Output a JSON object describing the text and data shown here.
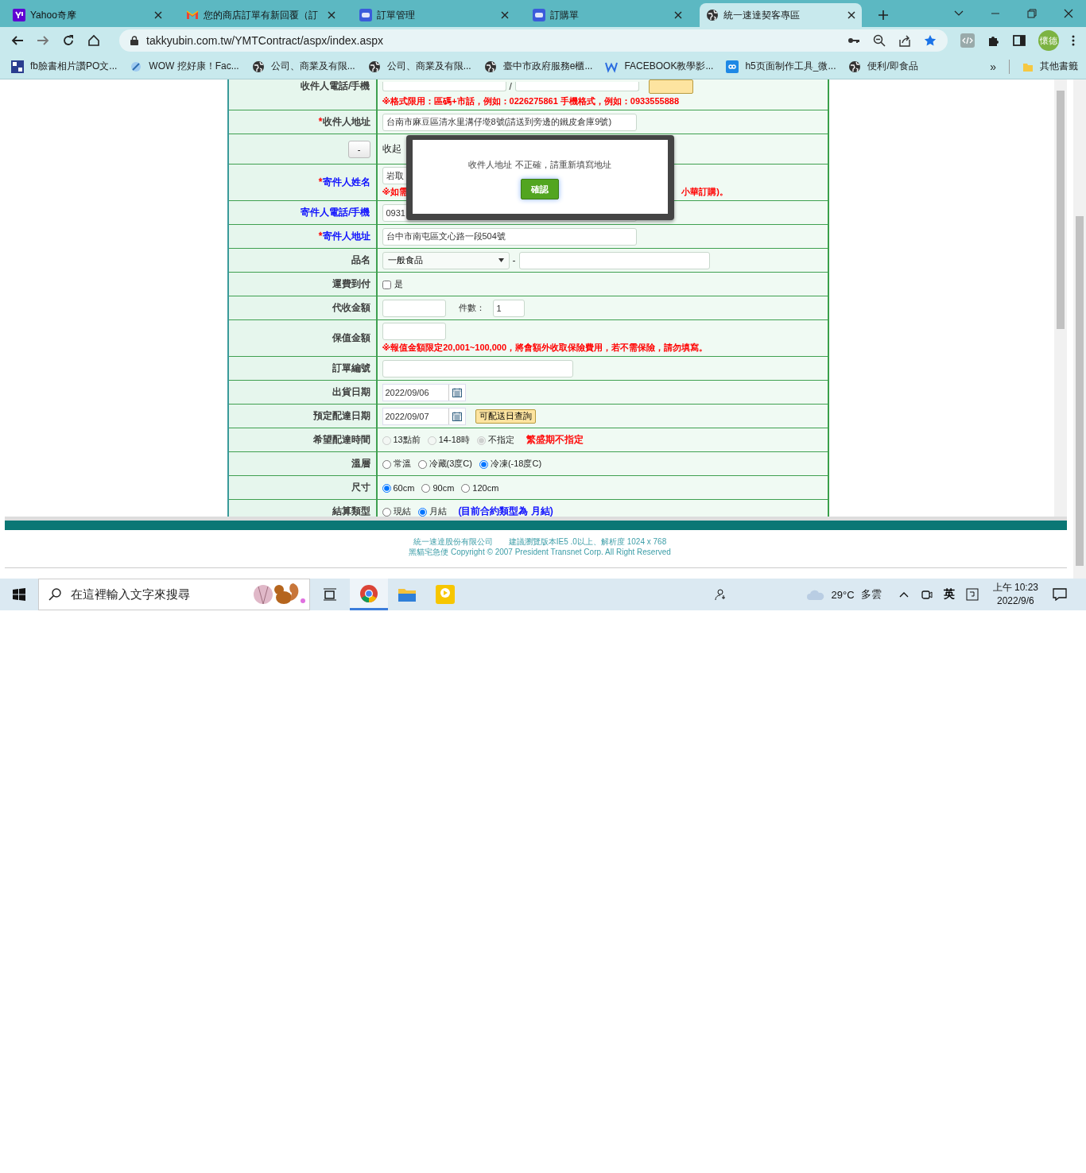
{
  "browser": {
    "tabs": [
      {
        "title": "Yahoo奇摩",
        "selected": false
      },
      {
        "title": "您的商店訂單有新回覆（訂",
        "selected": false
      },
      {
        "title": "訂單管理",
        "selected": false
      },
      {
        "title": "訂購單",
        "selected": false
      },
      {
        "title": "統一速達契客專區",
        "selected": true
      }
    ],
    "url": "takkyubin.com.tw/YMTContract/aspx/index.aspx",
    "profile": "懷德",
    "bookmarks": [
      "fb臉書相片讚PO文...",
      "WOW 挖好康！Fac...",
      "公司、商業及有限...",
      "公司、商業及有限...",
      "臺中市政府服務e櫃...",
      "FACEBOOK教學影...",
      "h5页面制作工具_微...",
      "便利/即食品"
    ],
    "more": "»",
    "other_bookmarks": "其他書籤"
  },
  "form": {
    "rows": [
      {
        "kind": "phone",
        "label": "收件人電話/手機",
        "separator": "/",
        "button": true,
        "note": {
          "text": "※格式限用：區碼+市話，例如：0226275861 手機格式，例如：0933555888",
          "color": "#ff0000"
        }
      },
      {
        "kind": "text",
        "label": "收件人地址",
        "required_mark": "*",
        "value": "台南市麻豆區清水里溝仔墘8號(請送到旁邊的鐵皮倉庫9號)"
      },
      {
        "kind": "collapse",
        "button": "-",
        "text": "收起"
      },
      {
        "kind": "text",
        "label": "寄件人姓名",
        "required_mark": "*",
        "color": "#0000ff",
        "value": "岩取",
        "note": {
          "parts": [
            "※如需",
            "小華訂購)。"
          ],
          "color": "#ff0000"
        }
      },
      {
        "kind": "text",
        "label": "寄件人電話/手機",
        "color": "#0000ff",
        "value": "0931"
      },
      {
        "kind": "text",
        "label": "寄件人地址",
        "required_mark": "*",
        "color": "#0000ff",
        "value": "台中市南屯區文心路一段504號"
      },
      {
        "kind": "select",
        "label": "品名",
        "value": "一般食品",
        "separator": "-",
        "extra": ""
      },
      {
        "kind": "checkbox",
        "label": "運費到付",
        "option": {
          "label": "是",
          "checked": false
        }
      },
      {
        "kind": "amount",
        "label": "代收金額",
        "value": "",
        "count_label": "件數：",
        "count": "1"
      },
      {
        "kind": "text",
        "label": "保值金額",
        "value": "",
        "note": {
          "text": "※報值金額限定20,001~100,000，將會額外收取保險費用，若不需保險，請勿填寫。",
          "color": "#ff0000"
        }
      },
      {
        "kind": "text",
        "label": "訂單編號",
        "value": ""
      },
      {
        "kind": "date",
        "label": "出貨日期",
        "value": "2022/09/06"
      },
      {
        "kind": "date",
        "label": "預定配達日期",
        "value": "2022/09/07",
        "button": "可配送日查詢"
      },
      {
        "kind": "radios",
        "label": "希望配達時間",
        "options": [
          {
            "label": "13點前",
            "selected": false,
            "disabled": true
          },
          {
            "label": "14-18時",
            "selected": false,
            "disabled": true
          },
          {
            "label": "不指定",
            "selected": true,
            "disabled": true
          }
        ],
        "note": {
          "text": "繁盛期不指定",
          "color": "#ff0000"
        }
      },
      {
        "kind": "radios",
        "label": "溫層",
        "options": [
          {
            "label": "常溫",
            "selected": false,
            "disabled": false
          },
          {
            "label": "冷藏(3度C)",
            "selected": false,
            "disabled": false
          },
          {
            "label": "冷凍(-18度C)",
            "selected": true,
            "disabled": false
          }
        ]
      },
      {
        "kind": "radios",
        "label": "尺寸",
        "options": [
          {
            "label": "60cm",
            "selected": true,
            "disabled": false
          },
          {
            "label": "90cm",
            "selected": false,
            "disabled": false
          },
          {
            "label": "120cm",
            "selected": false,
            "disabled": false
          }
        ]
      },
      {
        "kind": "radios",
        "label": "結算類型",
        "options": [
          {
            "label": "現結",
            "selected": false,
            "disabled": false
          },
          {
            "label": "月結",
            "selected": true,
            "disabled": false
          }
        ],
        "note": {
          "text": "(目前合約類型為 月結)",
          "color": "#0000ff"
        }
      }
    ]
  },
  "dialog": {
    "message": "收件人地址 不正確，請重新填寫地址",
    "button": "確認"
  },
  "footer": {
    "lines": [
      "統一速達股份有限公司　　建議瀏覽版本IE5 .0以上、解析度 1024 x 768",
      "黑貓宅急便 Copyright © 2007 President Transnet Corp. All Right Reserved"
    ]
  },
  "taskbar": {
    "search_placeholder": "在這裡輸入文字來搜尋",
    "temperature": "29°C",
    "weather": "多雲",
    "ime": "英",
    "time": "上午 10:23",
    "date": "2022/9/6"
  }
}
